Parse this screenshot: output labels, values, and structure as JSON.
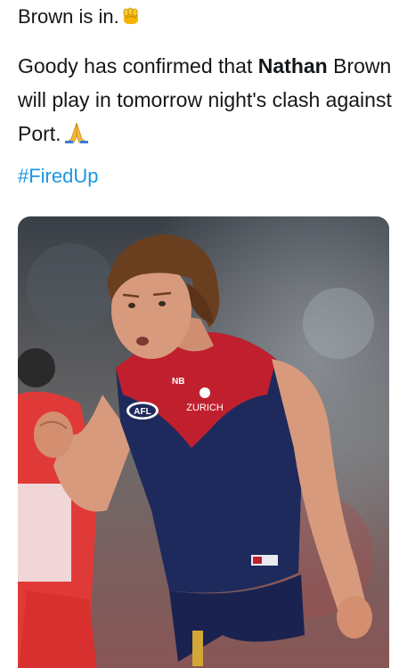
{
  "tweet": {
    "headline": "Brown is in.",
    "body_prefix": "Goody has confirmed that ",
    "body_bold": "Nathan",
    "body_suffix": " Brown will play in tomorrow night's clash against Port.",
    "hashtag": "#FiredUp"
  },
  "photo": {
    "guernsey_sponsor": "ZURICH",
    "guernsey_logo": "AFL",
    "colors": {
      "navy": "#1f2a5c",
      "red": "#c0202e",
      "skin": "#d89a7c",
      "hair": "#6a3f1f",
      "opponent_red": "#e03a38"
    }
  },
  "icons": [
    "raised-fist-emoji-icon",
    "folded-hands-emoji-icon"
  ]
}
